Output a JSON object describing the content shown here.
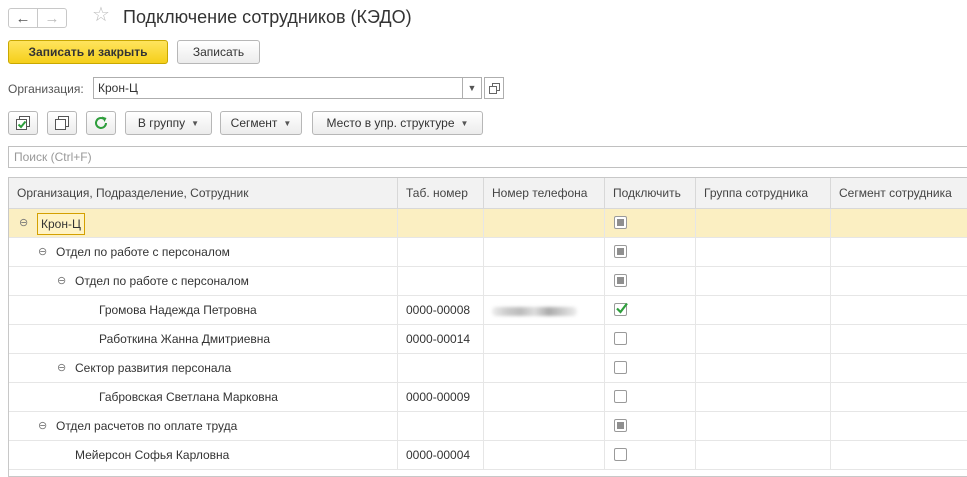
{
  "window": {
    "title": "Подключение сотрудников (КЭДО)",
    "nav_back": "←",
    "nav_forward": "→",
    "favorite_icon": "star-icon"
  },
  "commands": {
    "save_close": "Записать и закрыть",
    "save": "Записать"
  },
  "organization": {
    "label": "Организация:",
    "value": "Крон-Ц"
  },
  "toolbar": {
    "check_all_icon": "check-all-icon",
    "copy_icon": "copy-icon",
    "refresh_icon": "refresh-icon",
    "to_group": "В группу",
    "segment": "Сегмент",
    "place_structure": "Место в упр. структуре"
  },
  "search": {
    "placeholder": "Поиск (Ctrl+F)"
  },
  "table": {
    "columns": [
      "Организация, Подразделение, Сотрудник",
      "Таб. номер",
      "Номер телефона",
      "Подключить",
      "Группа сотрудника",
      "Сегмент сотрудника"
    ],
    "rows": [
      {
        "level": 0,
        "toggle": "⊖",
        "name": "Крон-Ц",
        "tab": "",
        "phone": "",
        "connect": "indeterminate",
        "selected": true
      },
      {
        "level": 1,
        "toggle": "⊖",
        "name": "Отдел по работе с персоналом",
        "tab": "",
        "phone": "",
        "connect": "indeterminate"
      },
      {
        "level": 2,
        "toggle": "⊖",
        "name": "Отдел по работе с персоналом",
        "tab": "",
        "phone": "",
        "connect": "indeterminate"
      },
      {
        "level": 3,
        "toggle": "",
        "name": "Громова Надежда Петровна",
        "tab": "0000-00008",
        "phone": "hidden",
        "connect": "checked"
      },
      {
        "level": 3,
        "toggle": "",
        "name": "Работкина Жанна Дмитриевна",
        "tab": "0000-00014",
        "phone": "",
        "connect": "unchecked"
      },
      {
        "level": 2,
        "toggle": "⊖",
        "name": "Сектор развития персонала",
        "tab": "",
        "phone": "",
        "connect": "unchecked"
      },
      {
        "level": 3,
        "toggle": "",
        "name": "Габровская Светлана Марковна",
        "tab": "0000-00009",
        "phone": "",
        "connect": "unchecked"
      },
      {
        "level": 1,
        "toggle": "⊖",
        "name": "Отдел расчетов по оплате труда",
        "tab": "",
        "phone": "",
        "connect": "indeterminate"
      },
      {
        "level": 2,
        "toggle": "",
        "name": "Мейерсон Софья Карловна",
        "tab": "0000-00004",
        "phone": "",
        "connect": "unchecked"
      }
    ]
  },
  "colors": {
    "primary_button": "#f5cf1a",
    "selected_row": "#fbefc2",
    "check_green": "#2e9e3c"
  }
}
